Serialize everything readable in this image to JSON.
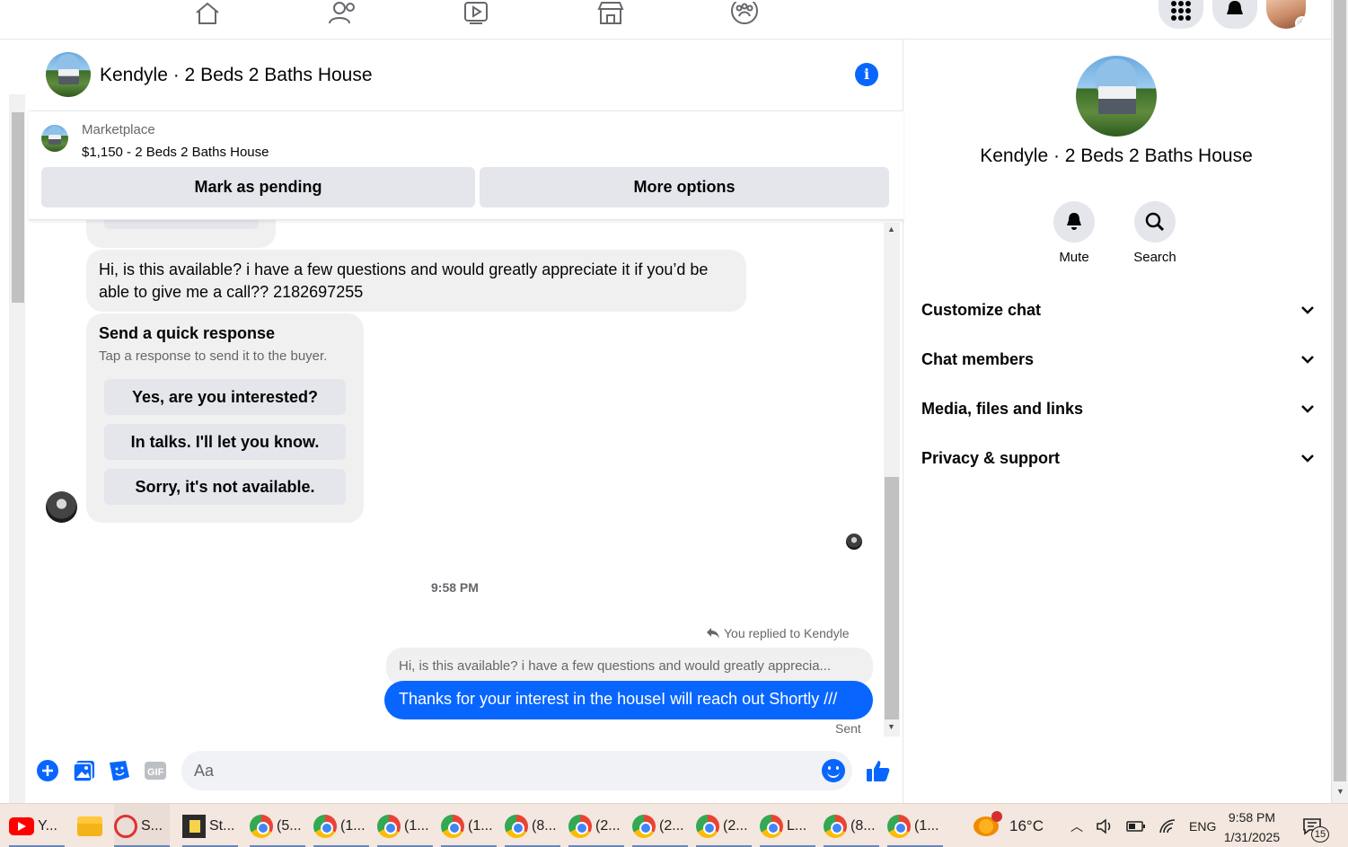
{
  "header": {
    "title": "Kendyle · 2 Beds 2 Baths House"
  },
  "listing": {
    "source": "Marketplace",
    "name": "$1,150 - 2 Beds 2 Baths House",
    "mark_pending": "Mark as pending",
    "more_options": "More options"
  },
  "messages": {
    "incoming_text": "Hi, is this available? i have a few questions and would greatly appreciate it if you’d be able to give me a call?? 2182697255",
    "quick_title": "Send a quick response",
    "quick_sub": "Tap a response to send it to the buyer.",
    "quick_options": [
      "Yes, are you interested?",
      "In talks. I'll let you know.",
      "Sorry, it's not available."
    ],
    "timestamp": "9:58 PM",
    "replied_label": "You replied to Kendyle",
    "quoted": "Hi, is this available? i have a few questions and would greatly apprecia...",
    "sent_text": "Thanks for your interest in the houseI will reach out Shortly ///",
    "sent_status": "Sent"
  },
  "composer": {
    "placeholder": "Aa"
  },
  "right_panel": {
    "title": "Kendyle · 2 Beds 2 Baths House",
    "mute": "Mute",
    "search": "Search",
    "sections": [
      "Customize chat",
      "Chat members",
      "Media, files and links",
      "Privacy & support"
    ]
  },
  "taskbar": {
    "items": [
      "Y...",
      "S...",
      "St...",
      "(5...",
      "(1...",
      "(1...",
      "(1...",
      "(8...",
      "(2...",
      "(2...",
      "(2...",
      "L...",
      "(8...",
      "(1..."
    ],
    "weather": "16°C",
    "language": "ENG",
    "time": "9:58 PM",
    "date": "1/31/2025",
    "notification_count": "15"
  },
  "colors": {
    "accent": "#0866ff",
    "bubble": "#f0f0f0",
    "button": "#e4e6eb"
  }
}
